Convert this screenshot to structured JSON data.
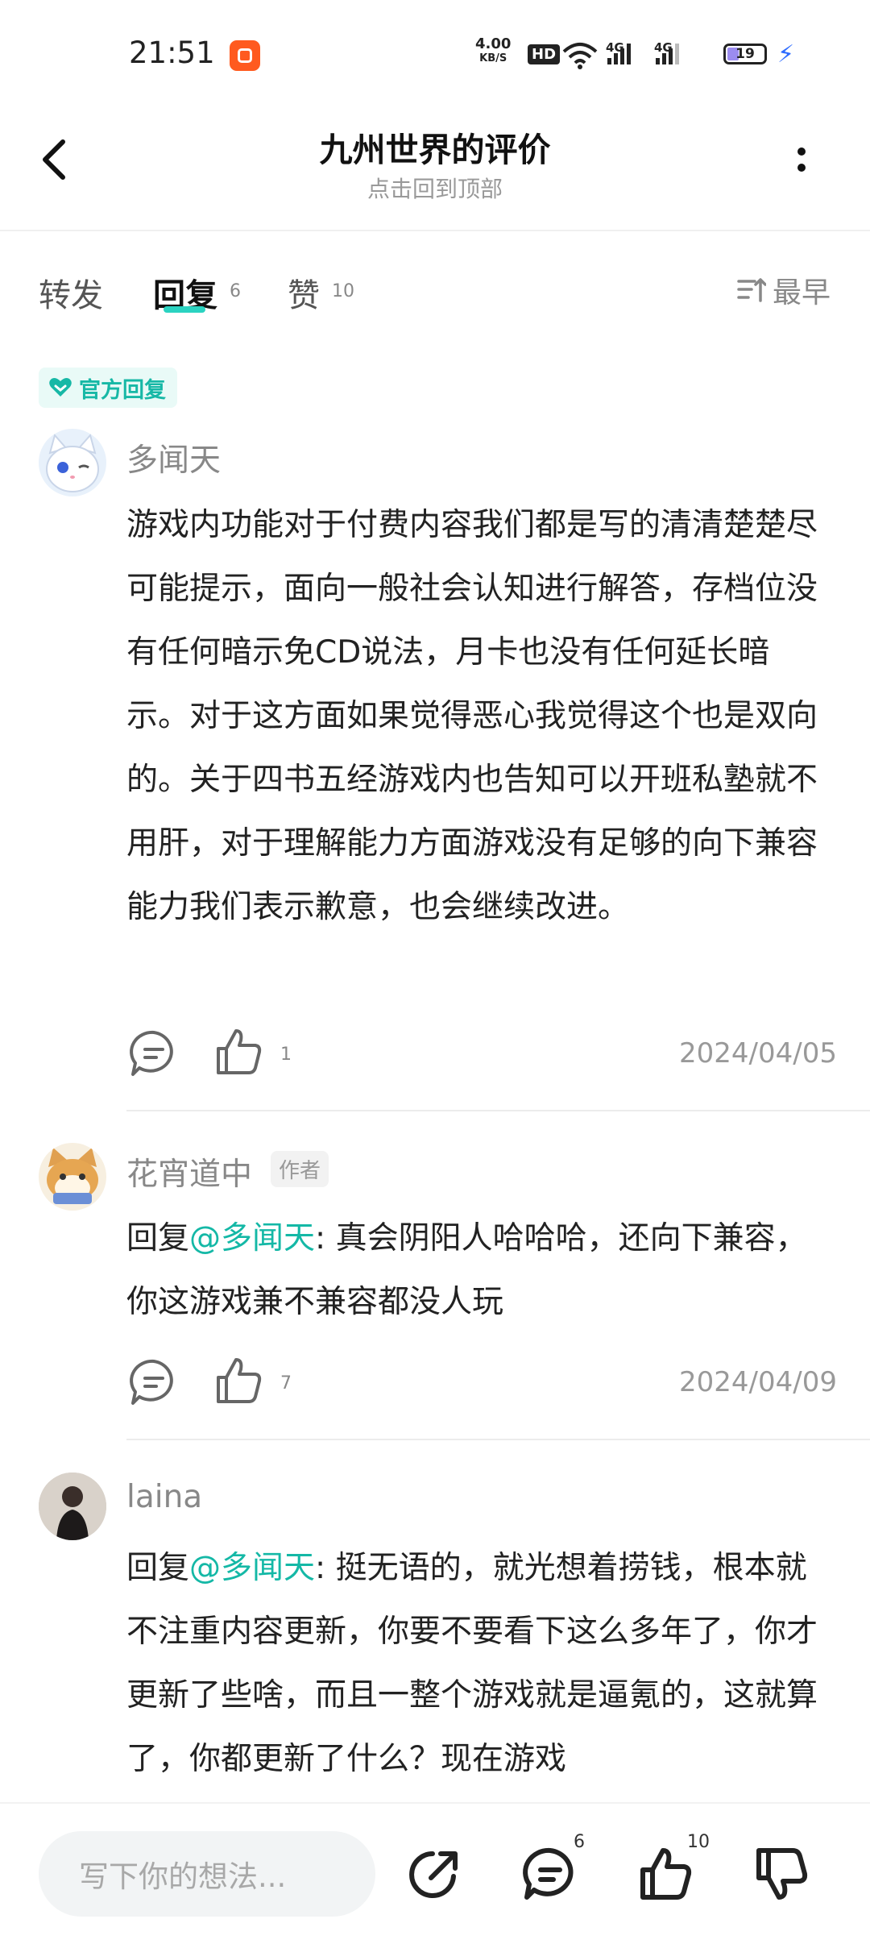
{
  "status_bar": {
    "time": "21:51",
    "net_speed_value": "4.00",
    "net_speed_unit": "KB/S",
    "hd_label": "HD",
    "signal_1": "4G",
    "signal_2": "4G",
    "battery": "19"
  },
  "header": {
    "title": "九州世界的评价",
    "subtitle": "点击回到顶部"
  },
  "tabs": {
    "repost": "转发",
    "reply": "回复",
    "reply_count": "6",
    "like": "赞",
    "like_count": "10",
    "sort": "最早"
  },
  "official_badge": "官方回复",
  "comments": [
    {
      "username": "多闻天",
      "text": "游戏内功能对于付费内容我们都是写的清清楚楚尽可能提示，面向一般社会认知进行解答，存档位没有任何暗示免CD说法，月卡也没有任何延长暗示。对于这方面如果觉得恶心我觉得这个也是双向的。关于四书五经游戏内也告知可以开班私塾就不用肝，对于理解能力方面游戏没有足够的向下兼容能力我们表示歉意，也会继续改进。",
      "likes": "1",
      "date": "2024/04/05"
    },
    {
      "username": "花宵道中",
      "author_tag": "作者",
      "reply_prefix": "回复",
      "mention": "@多闻天",
      "text": ": 真会阴阳人哈哈哈，还向下兼容，你这游戏兼不兼容都没人玩",
      "likes": "7",
      "date": "2024/04/09"
    },
    {
      "username": "laina",
      "reply_prefix": "回复",
      "mention": "@多闻天",
      "text": ": 挺无语的，就光想着捞钱，根本就不注重内容更新，你要不要看下这么多年了，你才更新了些啥，而且一整个游戏就是逼氪的，这就算了，你都更新了什么？现在游戏"
    }
  ],
  "bottom_bar": {
    "placeholder": "写下你的想法...",
    "comment_count": "6",
    "like_count": "10"
  },
  "colors": {
    "accent": "#2bd3c1",
    "mention": "#14b8a6",
    "official_bg": "#e9faf7"
  }
}
